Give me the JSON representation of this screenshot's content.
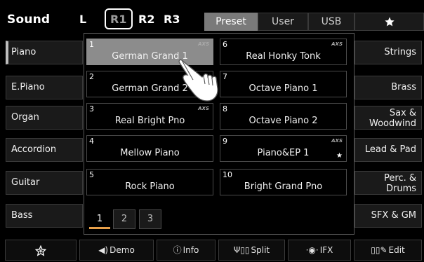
{
  "header": {
    "title": "Sound",
    "parts": [
      "L",
      "R1",
      "R2",
      "R3"
    ],
    "tabs": [
      "Preset",
      "User",
      "USB"
    ],
    "favorite_tab_icon": "star-icon"
  },
  "categories_left": [
    "Piano",
    "E.Piano",
    "Organ",
    "Accordion",
    "Guitar",
    "Bass"
  ],
  "categories_right": [
    {
      "line1": "Strings",
      "line2": ""
    },
    {
      "line1": "Brass",
      "line2": ""
    },
    {
      "line1": "Sax &",
      "line2": "Woodwind"
    },
    {
      "line1": "Lead & Pad",
      "line2": ""
    },
    {
      "line1": "Perc. &",
      "line2": "Drums"
    },
    {
      "line1": "SFX & GM",
      "line2": ""
    }
  ],
  "voices": [
    {
      "num": "1",
      "name": "German Grand 1",
      "badge": "AXS"
    },
    {
      "num": "2",
      "name": "German Grand 2",
      "badge": ""
    },
    {
      "num": "3",
      "name": "Real Bright Pno",
      "badge": "AXS"
    },
    {
      "num": "4",
      "name": "Mellow Piano",
      "badge": ""
    },
    {
      "num": "5",
      "name": "Rock Piano",
      "badge": ""
    },
    {
      "num": "6",
      "name": "Real Honky Tonk",
      "badge": "AXS"
    },
    {
      "num": "7",
      "name": "Octave Piano 1",
      "badge": ""
    },
    {
      "num": "8",
      "name": "Octave Piano 2",
      "badge": ""
    },
    {
      "num": "9",
      "name": "Piano&EP 1",
      "badge": "AXS"
    },
    {
      "num": "10",
      "name": "Bright Grand Pno",
      "badge": ""
    }
  ],
  "pages": [
    "1",
    "2",
    "3"
  ],
  "footer": {
    "demo": "Demo",
    "info": "Info",
    "split": "Split",
    "ifx": "IFX",
    "edit": "Edit"
  },
  "colors": {
    "selected_voice": "#8c8c8c",
    "active_page_underline": "#e8a04a",
    "button_bg": "#1a1a1a"
  }
}
